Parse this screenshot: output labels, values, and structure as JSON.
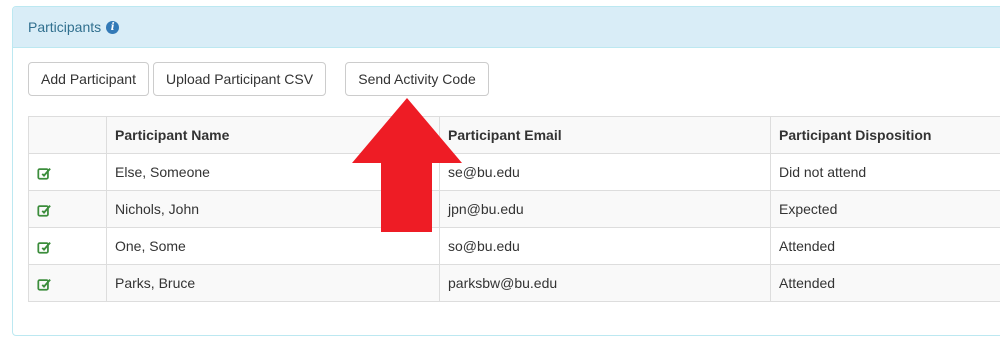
{
  "panel": {
    "title": "Participants"
  },
  "toolbar": {
    "add_label": "Add Participant",
    "upload_label": "Upload Participant CSV",
    "send_label": "Send Activity Code"
  },
  "table": {
    "headers": [
      "",
      "Participant Name",
      "Participant Email",
      "Participant Disposition"
    ],
    "rows": [
      {
        "name": "Else, Someone",
        "email": "se@bu.edu",
        "disposition": "Did not attend"
      },
      {
        "name": "Nichols, John",
        "email": "jpn@bu.edu",
        "disposition": "Expected"
      },
      {
        "name": "One, Some",
        "email": "so@bu.edu",
        "disposition": "Attended"
      },
      {
        "name": "Parks, Bruce",
        "email": "parksbw@bu.edu",
        "disposition": "Attended"
      }
    ]
  },
  "colors": {
    "heading_bg": "#d9edf7",
    "heading_text": "#31708f",
    "edit_icon": "#3c8d3c",
    "arrow": "#ee1c25"
  },
  "icons": {
    "info": "info-icon",
    "edit": "edit-icon",
    "annotation": "arrow-up-icon"
  }
}
